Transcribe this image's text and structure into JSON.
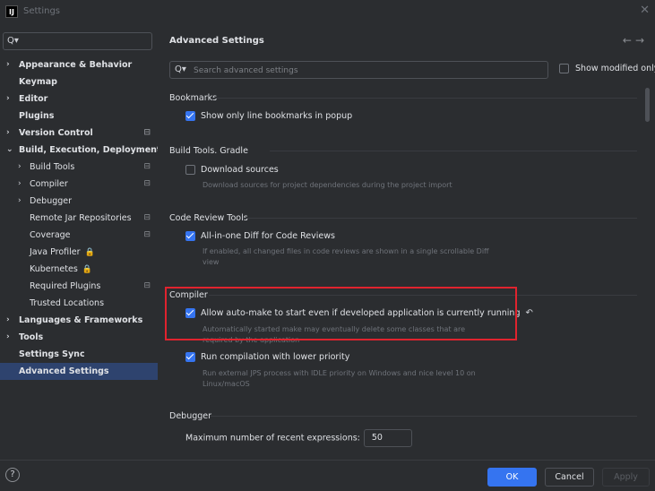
{
  "window": {
    "title": "Settings",
    "app_icon": "IJ"
  },
  "sidebar": {
    "search": {
      "icon": "search-icon",
      "placeholder": ""
    },
    "items": [
      {
        "label": "Appearance & Behavior",
        "chevron": "›",
        "indent": 0,
        "bold": true
      },
      {
        "label": "Keymap",
        "chevron": "",
        "indent": 0,
        "bold": true
      },
      {
        "label": "Editor",
        "chevron": "›",
        "indent": 0,
        "bold": true
      },
      {
        "label": "Plugins",
        "chevron": "",
        "indent": 0,
        "bold": true
      },
      {
        "label": "Version Control",
        "chevron": "›",
        "indent": 0,
        "bold": true,
        "badge": true
      },
      {
        "label": "Build, Execution, Deployment",
        "chevron": "⌄",
        "indent": 0,
        "bold": true
      },
      {
        "label": "Build Tools",
        "chevron": "›",
        "indent": 1,
        "bold": false,
        "badge": true
      },
      {
        "label": "Compiler",
        "chevron": "›",
        "indent": 1,
        "bold": false,
        "badge": true
      },
      {
        "label": "Debugger",
        "chevron": "›",
        "indent": 1,
        "bold": false
      },
      {
        "label": "Remote Jar Repositories",
        "chevron": "",
        "indent": 1,
        "bold": false,
        "badge": true
      },
      {
        "label": "Coverage",
        "chevron": "",
        "indent": 1,
        "bold": false,
        "badge": true
      },
      {
        "label": "Java Profiler",
        "chevron": "",
        "indent": 1,
        "bold": false,
        "lock": true
      },
      {
        "label": "Kubernetes",
        "chevron": "",
        "indent": 1,
        "bold": false,
        "lock": true
      },
      {
        "label": "Required Plugins",
        "chevron": "",
        "indent": 1,
        "bold": false,
        "badge": true
      },
      {
        "label": "Trusted Locations",
        "chevron": "",
        "indent": 1,
        "bold": false
      },
      {
        "label": "Languages & Frameworks",
        "chevron": "›",
        "indent": 0,
        "bold": true
      },
      {
        "label": "Tools",
        "chevron": "›",
        "indent": 0,
        "bold": true
      },
      {
        "label": "Settings Sync",
        "chevron": "",
        "indent": 0,
        "bold": true
      },
      {
        "label": "Advanced Settings",
        "chevron": "",
        "indent": 0,
        "bold": true,
        "selected": true
      }
    ]
  },
  "main": {
    "title": "Advanced Settings",
    "nav_back": "←",
    "nav_forward": "→",
    "search_placeholder": "Search advanced settings",
    "show_modified_label": "Show modified only",
    "show_modified_checked": false,
    "sections": {
      "bookmarks": {
        "title": "Bookmarks",
        "option": "Show only line bookmarks in popup",
        "checked": true
      },
      "gradle": {
        "title": "Build Tools. Gradle",
        "option": "Download sources",
        "checked": false,
        "desc": "Download sources for project dependencies during the project import"
      },
      "code_review": {
        "title": "Code Review Tools",
        "option": "All-in-one Diff for Code Reviews",
        "checked": true,
        "desc": "If enabled, all changed files in code reviews are shown in a single scrollable Diff view"
      },
      "compiler": {
        "title": "Compiler",
        "option1": "Allow auto-make to start even if developed application is currently running",
        "option1_checked": true,
        "option1_desc": "Automatically started make may eventually delete some classes that are required by the application",
        "option2": "Run compilation with lower priority",
        "option2_checked": true,
        "option2_desc": "Run external JPS process with IDLE priority on Windows and nice level 10 on Linux/macOS"
      },
      "debugger": {
        "title": "Debugger",
        "option": "Maximum number of recent expressions:",
        "value": "50"
      }
    }
  },
  "footer": {
    "help": "?",
    "ok": "OK",
    "cancel": "Cancel",
    "apply": "Apply"
  },
  "colors": {
    "accent": "#3574f0",
    "highlight_border": "#e0232e",
    "selected": "#2e436e"
  }
}
